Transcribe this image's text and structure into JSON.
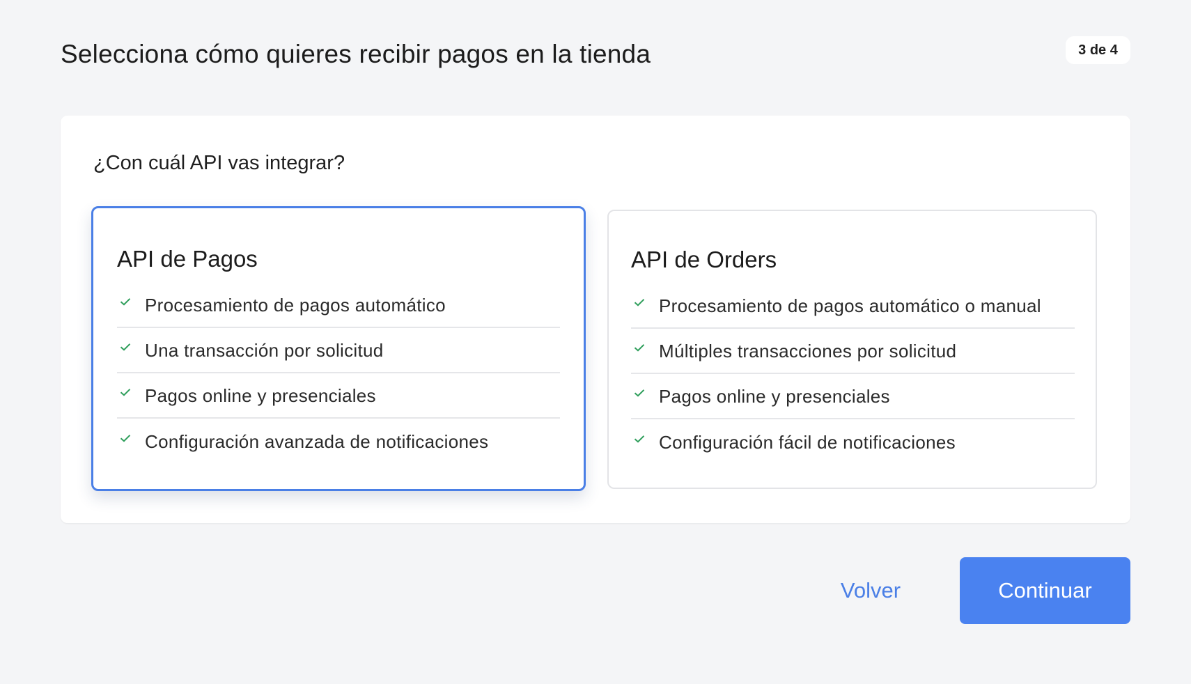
{
  "header": {
    "title": "Selecciona cómo quieres recibir pagos en la tienda",
    "step_indicator": "3 de 4"
  },
  "panel": {
    "question": "¿Con cuál API vas integrar?",
    "options": [
      {
        "title": "API de Pagos",
        "selected": true,
        "features": [
          "Procesamiento de pagos automático",
          "Una transacción por solicitud",
          "Pagos online y presenciales",
          "Configuración avanzada de notificaciones"
        ]
      },
      {
        "title": "API de Orders",
        "selected": false,
        "features": [
          "Procesamiento de pagos automático o manual",
          "Múltiples transacciones por solicitud",
          "Pagos online y presenciales",
          "Configuración fácil de notificaciones"
        ]
      }
    ]
  },
  "footer": {
    "back_label": "Volver",
    "continue_label": "Continuar"
  },
  "colors": {
    "background": "#f4f5f7",
    "accent": "#4a7fe6",
    "primary_button": "#4a82f0",
    "check": "#2e9e5b"
  },
  "icons": {
    "feature_check": "check-icon"
  }
}
